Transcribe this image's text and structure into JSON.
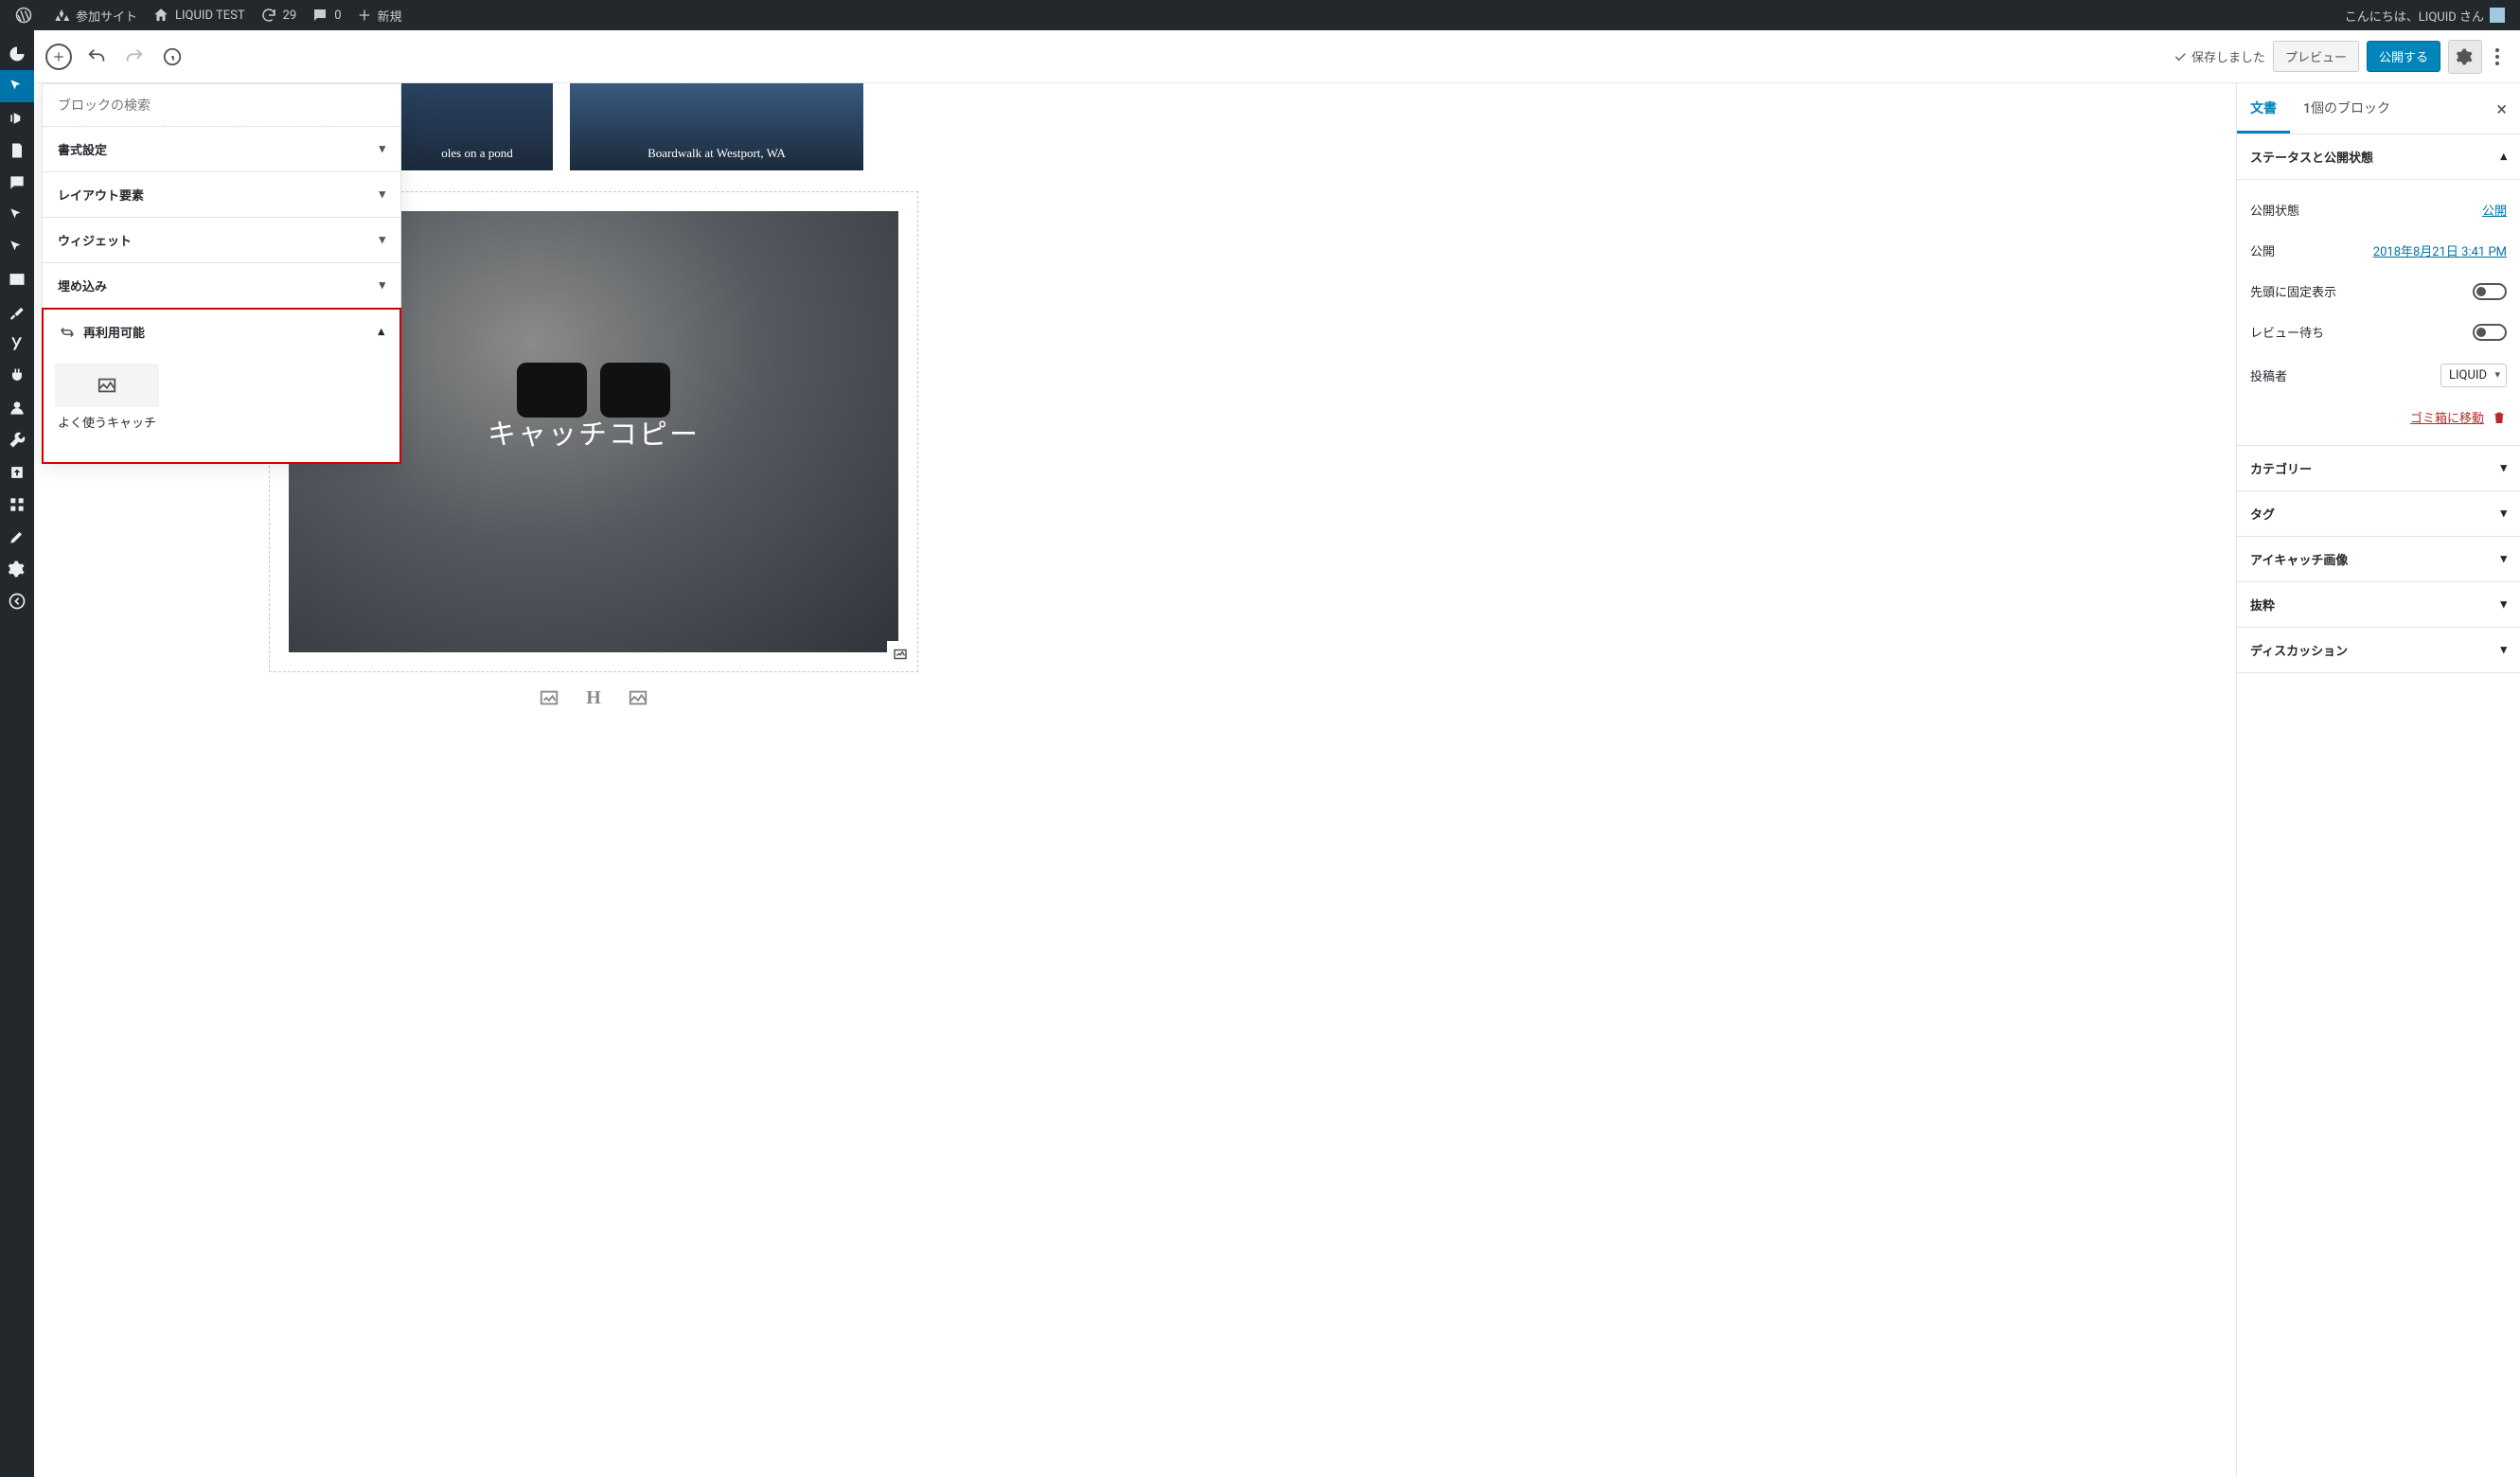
{
  "adminbar": {
    "sites": "参加サイト",
    "site_name": "LIQUID TEST",
    "updates": "29",
    "comments": "0",
    "new": "新規",
    "greeting": "こんにちは、LIQUID さん"
  },
  "toolbar": {
    "saved": "保存しました",
    "preview": "プレビュー",
    "publish": "公開する"
  },
  "inserter": {
    "search_placeholder": "ブロックの検索",
    "rows": {
      "formatting": "書式設定",
      "layout": "レイアウト要素",
      "widgets": "ウィジェット",
      "embeds": "埋め込み",
      "reusable": "再利用可能"
    },
    "reusable_block_label": "よく使うキャッチ"
  },
  "canvas": {
    "gallery": {
      "a": "oles on a pond",
      "b": "Boardwalk at Westport, WA"
    },
    "cover_text": "キャッチコピー"
  },
  "sidebar": {
    "tabs": {
      "document": "文書",
      "block": "1個のブロック"
    },
    "status_panel_title": "ステータスと公開状態",
    "visibility_label": "公開状態",
    "visibility_value": "公開",
    "publish_label": "公開",
    "publish_value": "2018年8月21日 3:41 PM",
    "sticky_label": "先頭に固定表示",
    "pending_label": "レビュー待ち",
    "author_label": "投稿者",
    "author_value": "LIQUID",
    "trash": "ゴミ箱に移動",
    "panels": {
      "categories": "カテゴリー",
      "tags": "タグ",
      "featured": "アイキャッチ画像",
      "excerpt": "抜粋",
      "discussion": "ディスカッション"
    }
  }
}
